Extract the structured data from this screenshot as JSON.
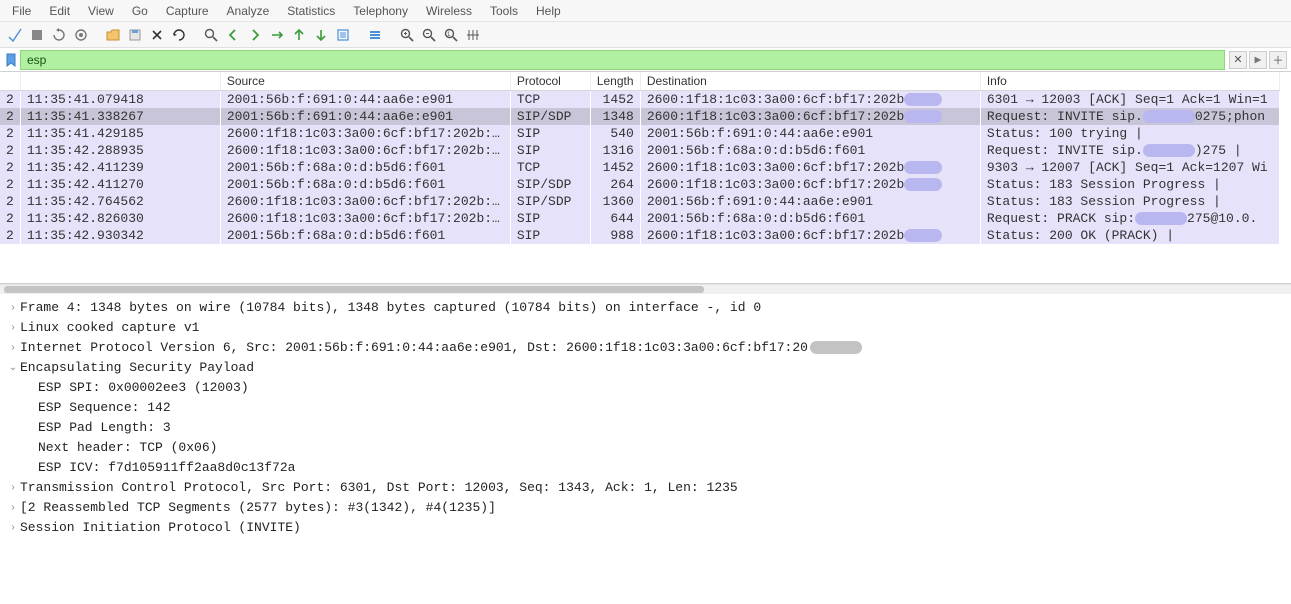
{
  "menubar": [
    "File",
    "Edit",
    "View",
    "Go",
    "Capture",
    "Analyze",
    "Statistics",
    "Telephony",
    "Wireless",
    "Tools",
    "Help"
  ],
  "filter": {
    "value": "esp"
  },
  "columns": {
    "no": "",
    "time": "",
    "source": "Source",
    "protocol": "Protocol",
    "length": "Length",
    "destination": "Destination",
    "info": "Info"
  },
  "packets": [
    {
      "no": "2",
      "time": "11:35:41.079418",
      "src": "2001:56b:f:691:0:44:aa6e:e901",
      "proto": "TCP",
      "len": "1452",
      "dst": "2600:1f18:1c03:3a00:6cf:bf17:202b",
      "dst_redact": true,
      "info": "6301 → 12003 [ACK] Seq=1 Ack=1 Win=1",
      "info_redact": null
    },
    {
      "no": "2",
      "time": "11:35:41.338267",
      "src": "2001:56b:f:691:0:44:aa6e:e901",
      "proto": "SIP/SDP",
      "len": "1348",
      "dst": "2600:1f18:1c03:3a00:6cf:bf17:202b",
      "dst_redact": true,
      "info_pre": "Request: INVITE sip.",
      "info_post": "0275;phon",
      "info_redact": "mid",
      "selected": true
    },
    {
      "no": "2",
      "time": "11:35:41.429185",
      "src": "2600:1f18:1c03:3a00:6cf:bf17:202b:…",
      "proto": "SIP",
      "len": "540",
      "dst": "2001:56b:f:691:0:44:aa6e:e901",
      "info": "Status: 100 trying |"
    },
    {
      "no": "2",
      "time": "11:35:42.288935",
      "src": "2600:1f18:1c03:3a00:6cf:bf17:202b:…",
      "proto": "SIP",
      "len": "1316",
      "dst": "2001:56b:f:68a:0:d:b5d6:f601",
      "info_pre": "Request: INVITE sip.",
      "info_post": ")275 |",
      "info_redact": "mid"
    },
    {
      "no": "2",
      "time": "11:35:42.411239",
      "src": "2001:56b:f:68a:0:d:b5d6:f601",
      "proto": "TCP",
      "len": "1452",
      "dst": "2600:1f18:1c03:3a00:6cf:bf17:202b",
      "dst_redact": true,
      "info": "9303 → 12007 [ACK] Seq=1 Ack=1207 Wi"
    },
    {
      "no": "2",
      "time": "11:35:42.411270",
      "src": "2001:56b:f:68a:0:d:b5d6:f601",
      "proto": "SIP/SDP",
      "len": "264",
      "dst": "2600:1f18:1c03:3a00:6cf:bf17:202b",
      "dst_redact": true,
      "info": "Status: 183 Session Progress |"
    },
    {
      "no": "2",
      "time": "11:35:42.764562",
      "src": "2600:1f18:1c03:3a00:6cf:bf17:202b:…",
      "proto": "SIP/SDP",
      "len": "1360",
      "dst": "2001:56b:f:691:0:44:aa6e:e901",
      "info": "Status: 183 Session Progress |"
    },
    {
      "no": "2",
      "time": "11:35:42.826030",
      "src": "2600:1f18:1c03:3a00:6cf:bf17:202b:…",
      "proto": "SIP",
      "len": "644",
      "dst": "2001:56b:f:68a:0:d:b5d6:f601",
      "info_pre": "Request: PRACK sip:",
      "info_post": "275@10.0.",
      "info_redact": "mid"
    },
    {
      "no": "2",
      "time": "11:35:42.930342",
      "src": "2001:56b:f:68a:0:d:b5d6:f601",
      "proto": "SIP",
      "len": "988",
      "dst": "2600:1f18:1c03:3a00:6cf:bf17:202b",
      "dst_redact": true,
      "info": "Status: 200 OK (PRACK) |"
    }
  ],
  "details": {
    "frame": "Frame 4: 1348 bytes on wire (10784 bits), 1348 bytes captured (10784 bits) on interface -, id 0",
    "linux": "Linux cooked capture v1",
    "ipv6_pre": "Internet Protocol Version 6, Src: 2001:56b:f:691:0:44:aa6e:e901, Dst: 2600:1f18:1c03:3a00:6cf:bf17:20",
    "esp_header": "Encapsulating Security Payload",
    "esp": {
      "spi": "ESP SPI: 0x00002ee3 (12003)",
      "seq": "ESP Sequence: 142",
      "pad": "ESP Pad Length: 3",
      "next": "Next header: TCP (0x06)",
      "icv": "ESP ICV: f7d105911ff2aa8d0c13f72a"
    },
    "tcp": "Transmission Control Protocol, Src Port: 6301, Dst Port: 12003, Seq: 1343, Ack: 1, Len: 1235",
    "reasm": "[2 Reassembled TCP Segments (2577 bytes): #3(1342), #4(1235)]",
    "sip": "Session Initiation Protocol (INVITE)"
  }
}
